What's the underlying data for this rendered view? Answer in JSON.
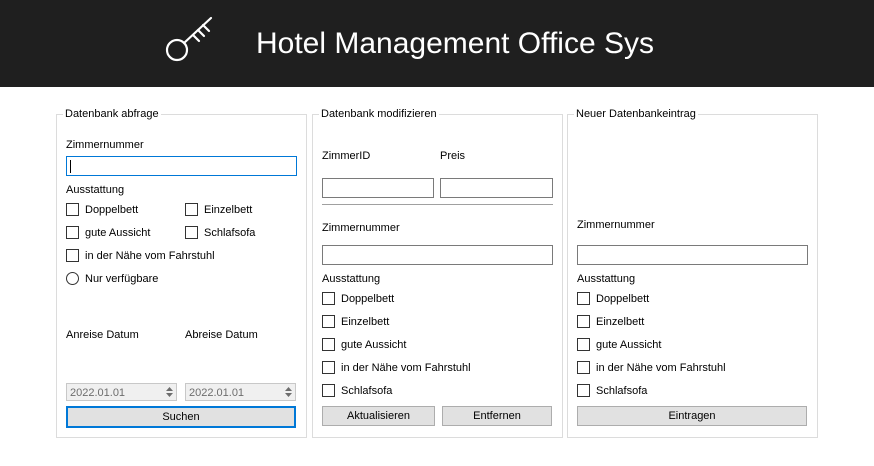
{
  "header": {
    "title": "Hotel Management Office Sys"
  },
  "query": {
    "title": "Datenbank abfrage",
    "room_label": "Zimmernummer",
    "room_value": "",
    "equip_label": "Ausstattung",
    "opt_doppelbett": "Doppelbett",
    "opt_einzelbett": "Einzelbett",
    "opt_aussicht": "gute Aussicht",
    "opt_schlafsofa": "Schlafsofa",
    "opt_fahrstuhl": "in der Nähe vom Fahrstuhl",
    "opt_available": "Nur verfügbare",
    "arrival_label": "Anreise Datum",
    "departure_label": "Abreise Datum",
    "arrival_value": "2022.01.01",
    "departure_value": "2022.01.01",
    "search_button": "Suchen"
  },
  "modify": {
    "title": "Datenbank modifizieren",
    "id_label": "ZimmerID",
    "price_label": "Preis",
    "room_label": "Zimmernummer",
    "equip_label": "Ausstattung",
    "opt_doppelbett": "Doppelbett",
    "opt_einzelbett": "Einzelbett",
    "opt_aussicht": "gute Aussicht",
    "opt_fahrstuhl": "in der Nähe vom Fahrstuhl",
    "opt_schlafsofa": "Schlafsofa",
    "update_button": "Aktualisieren",
    "remove_button": "Entfernen"
  },
  "new_entry": {
    "title": "Neuer Datenbankeintrag",
    "room_label": "Zimmernummer",
    "equip_label": "Ausstattung",
    "opt_doppelbett": "Doppelbett",
    "opt_einzelbett": "Einzelbett",
    "opt_aussicht": "gute Aussicht",
    "opt_fahrstuhl": "in der Nähe vom Fahrstuhl",
    "opt_schlafsofa": "Schlafsofa",
    "add_button": "Eintragen"
  }
}
